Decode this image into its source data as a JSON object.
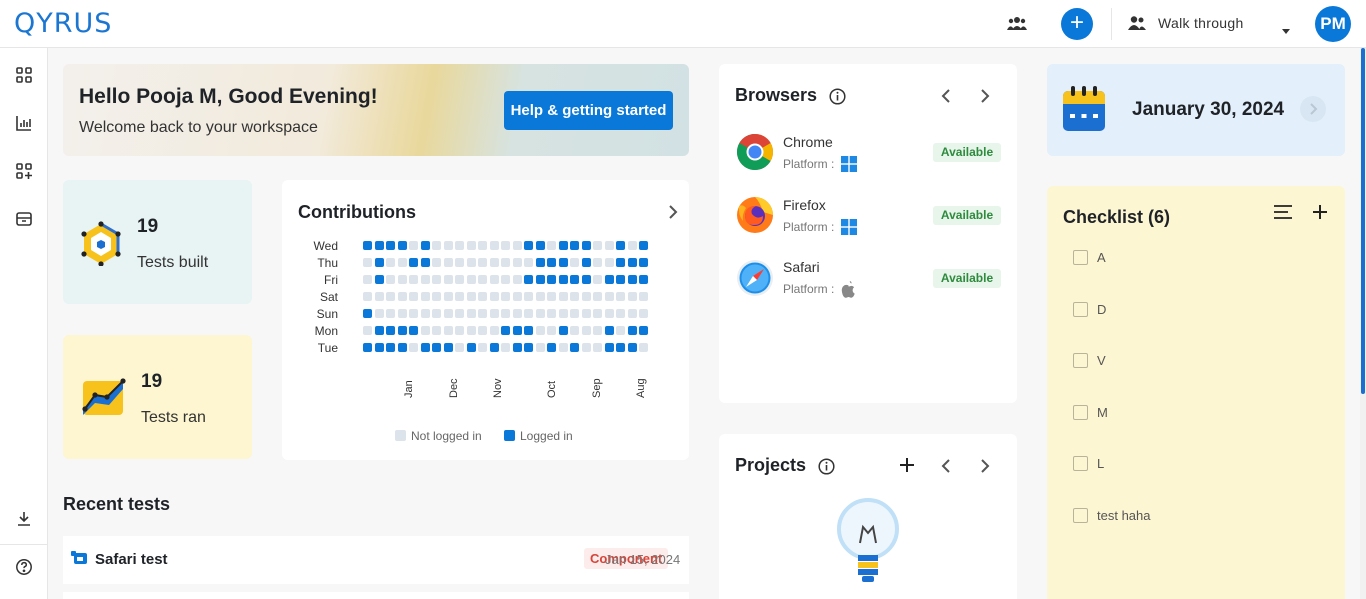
{
  "app": {
    "logo": "QYRUS"
  },
  "header": {
    "walkthrough_label": "Walk through",
    "avatar_initials": "PM"
  },
  "welcome": {
    "greeting": "Hello Pooja M, Good Evening!",
    "subtitle": "Welcome back to your workspace",
    "help_button": "Help & getting started"
  },
  "stats": {
    "built": {
      "value": "19",
      "label": "Tests built"
    },
    "ran": {
      "value": "19",
      "label": "Tests ran"
    }
  },
  "contributions": {
    "title": "Contributions",
    "days": [
      "Wed",
      "Thu",
      "Fri",
      "Sat",
      "Sun",
      "Mon",
      "Tue"
    ],
    "months": [
      "Jan",
      "Dec",
      "Nov",
      "Oct",
      "Sep",
      "Aug"
    ],
    "legend": {
      "not_logged": "Not logged in",
      "logged": "Logged in"
    },
    "colors": {
      "logged": "#0a78d8",
      "not_logged": "#dde3ea"
    },
    "grid": [
      "1111010000000011011100101",
      "0100110000000001110100111",
      "0100000000000011111101111",
      "0000000000000000000000000",
      "1000000000000000000000000",
      "0111100000001110010001011",
      "1111011101010110101001110"
    ]
  },
  "recent": {
    "title": "Recent tests",
    "items": [
      {
        "name": "Safari test",
        "type": "Component",
        "date": "Jan 15, 2024"
      }
    ]
  },
  "browsers": {
    "title": "Browsers",
    "items": [
      {
        "name": "Chrome",
        "platform_label": "Platform :",
        "platform_icon": "windows-icon",
        "status": "Available"
      },
      {
        "name": "Firefox",
        "platform_label": "Platform :",
        "platform_icon": "windows-icon",
        "status": "Available"
      },
      {
        "name": "Safari",
        "platform_label": "Platform :",
        "platform_icon": "apple-icon",
        "status": "Available"
      }
    ]
  },
  "projects": {
    "title": "Projects"
  },
  "calendar": {
    "date": "January 30, 2024"
  },
  "checklist": {
    "title": "Checklist (6)",
    "items": [
      "A",
      "D",
      "V",
      "M",
      "L",
      "test haha"
    ]
  },
  "colors": {
    "accent": "#0a78d8",
    "available_bg": "#e8f5ea",
    "checklist_bg": "#fdf6d2",
    "calendar_bg": "#e3effa"
  }
}
